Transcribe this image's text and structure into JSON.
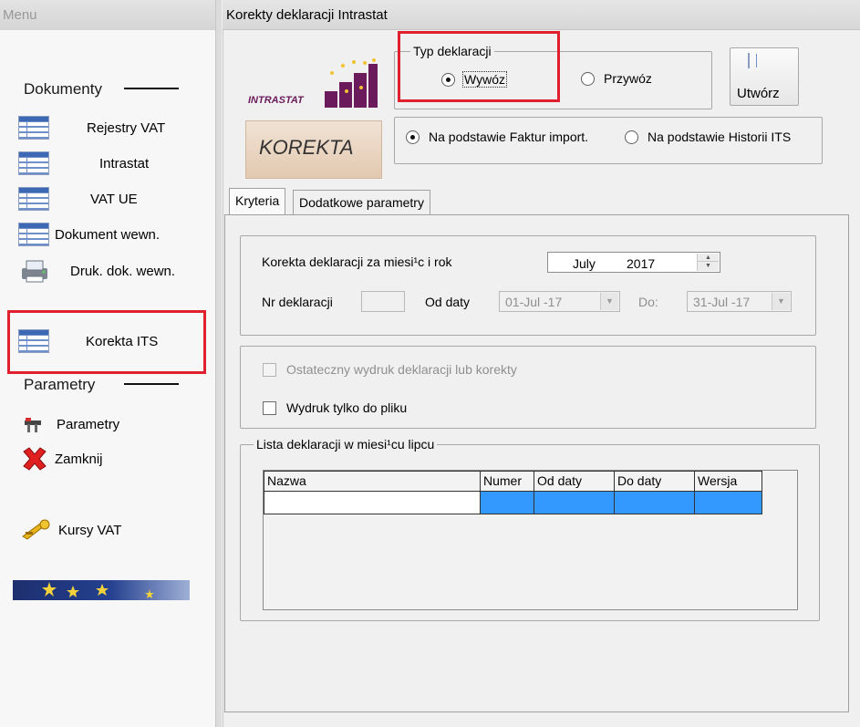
{
  "menu": {
    "title": "Menu",
    "dokumenty_header": "Dokumenty",
    "items": [
      {
        "label": "Rejestry VAT",
        "icon": "table-icon"
      },
      {
        "label": "Intrastat",
        "icon": "table-icon"
      },
      {
        "label": "VAT UE",
        "icon": "table-icon"
      },
      {
        "label": "Dokument wewn.",
        "icon": "table-icon"
      },
      {
        "label": "Druk. dok. wewn.",
        "icon": "printer-icon"
      }
    ],
    "korekta_item": {
      "label": "Korekta ITS",
      "icon": "table-icon"
    },
    "parametry_header": "Parametry",
    "param_items": [
      {
        "label": "Parametry",
        "icon": "tools-icon"
      },
      {
        "label": "Zamknij",
        "icon": "close-x-icon"
      }
    ],
    "kursy_item": {
      "label": "Kursy VAT",
      "icon": "key-icon"
    }
  },
  "window": {
    "title": "Korekty deklaracji Intrastat",
    "logo_text": "INTRASTAT",
    "korekta_banner": "KOREKTA",
    "typ_group": "Typ deklaracji",
    "radio_wywoz": "Wywóz",
    "radio_przywoz": "Przywóz",
    "create_button": "Utwórz",
    "radio_faktur": "Na podstawie Faktur import.",
    "radio_historii": "Na podstawie Historii ITS",
    "tabs": [
      "Kryteria",
      "Dodatkowe parametry"
    ],
    "korekta_label": "Korekta deklaracji za miesi¹c i rok",
    "month_value": "July",
    "year_value": "2017",
    "nr_label": "Nr deklaracji",
    "od_label": "Od daty",
    "od_value": "01-Jul -17",
    "do_label": "Do:",
    "do_value": "31-Jul -17",
    "chk_ostateczny": "Ostateczny wydruk deklaracji lub korekty",
    "chk_wydruk": "Wydruk tylko do pliku",
    "list_group": "Lista deklaracji w miesi¹cu lipcu",
    "columns": [
      "Nazwa",
      "Numer",
      "Od daty",
      "Do daty",
      "Wersja"
    ]
  },
  "colors": {
    "highlight_red": "#e0202e",
    "selection_blue": "#3399ff",
    "logo_purple": "#6b1b5c"
  }
}
